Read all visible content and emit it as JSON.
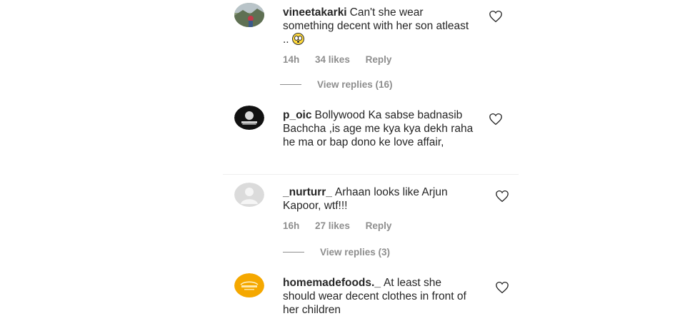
{
  "comments": [
    {
      "username": "vineetakarki",
      "text": "Can't she wear something decent with her son atleast ..",
      "emoji": "face-with-rolling-eyes-emoji",
      "time": "14h",
      "likes": "34 likes",
      "reply_label": "Reply",
      "view_replies": "View replies (16)"
    },
    {
      "username": "p_oic",
      "text": "Bollywood Ka sabse badnasib Bachcha ,is age me kya kya dekh raha he ma or bap dono ke love affair,"
    },
    {
      "username": "_nurturr_",
      "text": "Arhaan looks like Arjun Kapoor, wtf!!!",
      "time": "16h",
      "likes": "27 likes",
      "reply_label": "Reply",
      "view_replies": "View replies (3)"
    },
    {
      "username": "homemadefoods._",
      "text": "At least she should wear decent clothes in front of her children"
    }
  ],
  "colors": {
    "text": "#262626",
    "meta": "#8e8e8e",
    "avatar_food": "#f5a800"
  }
}
